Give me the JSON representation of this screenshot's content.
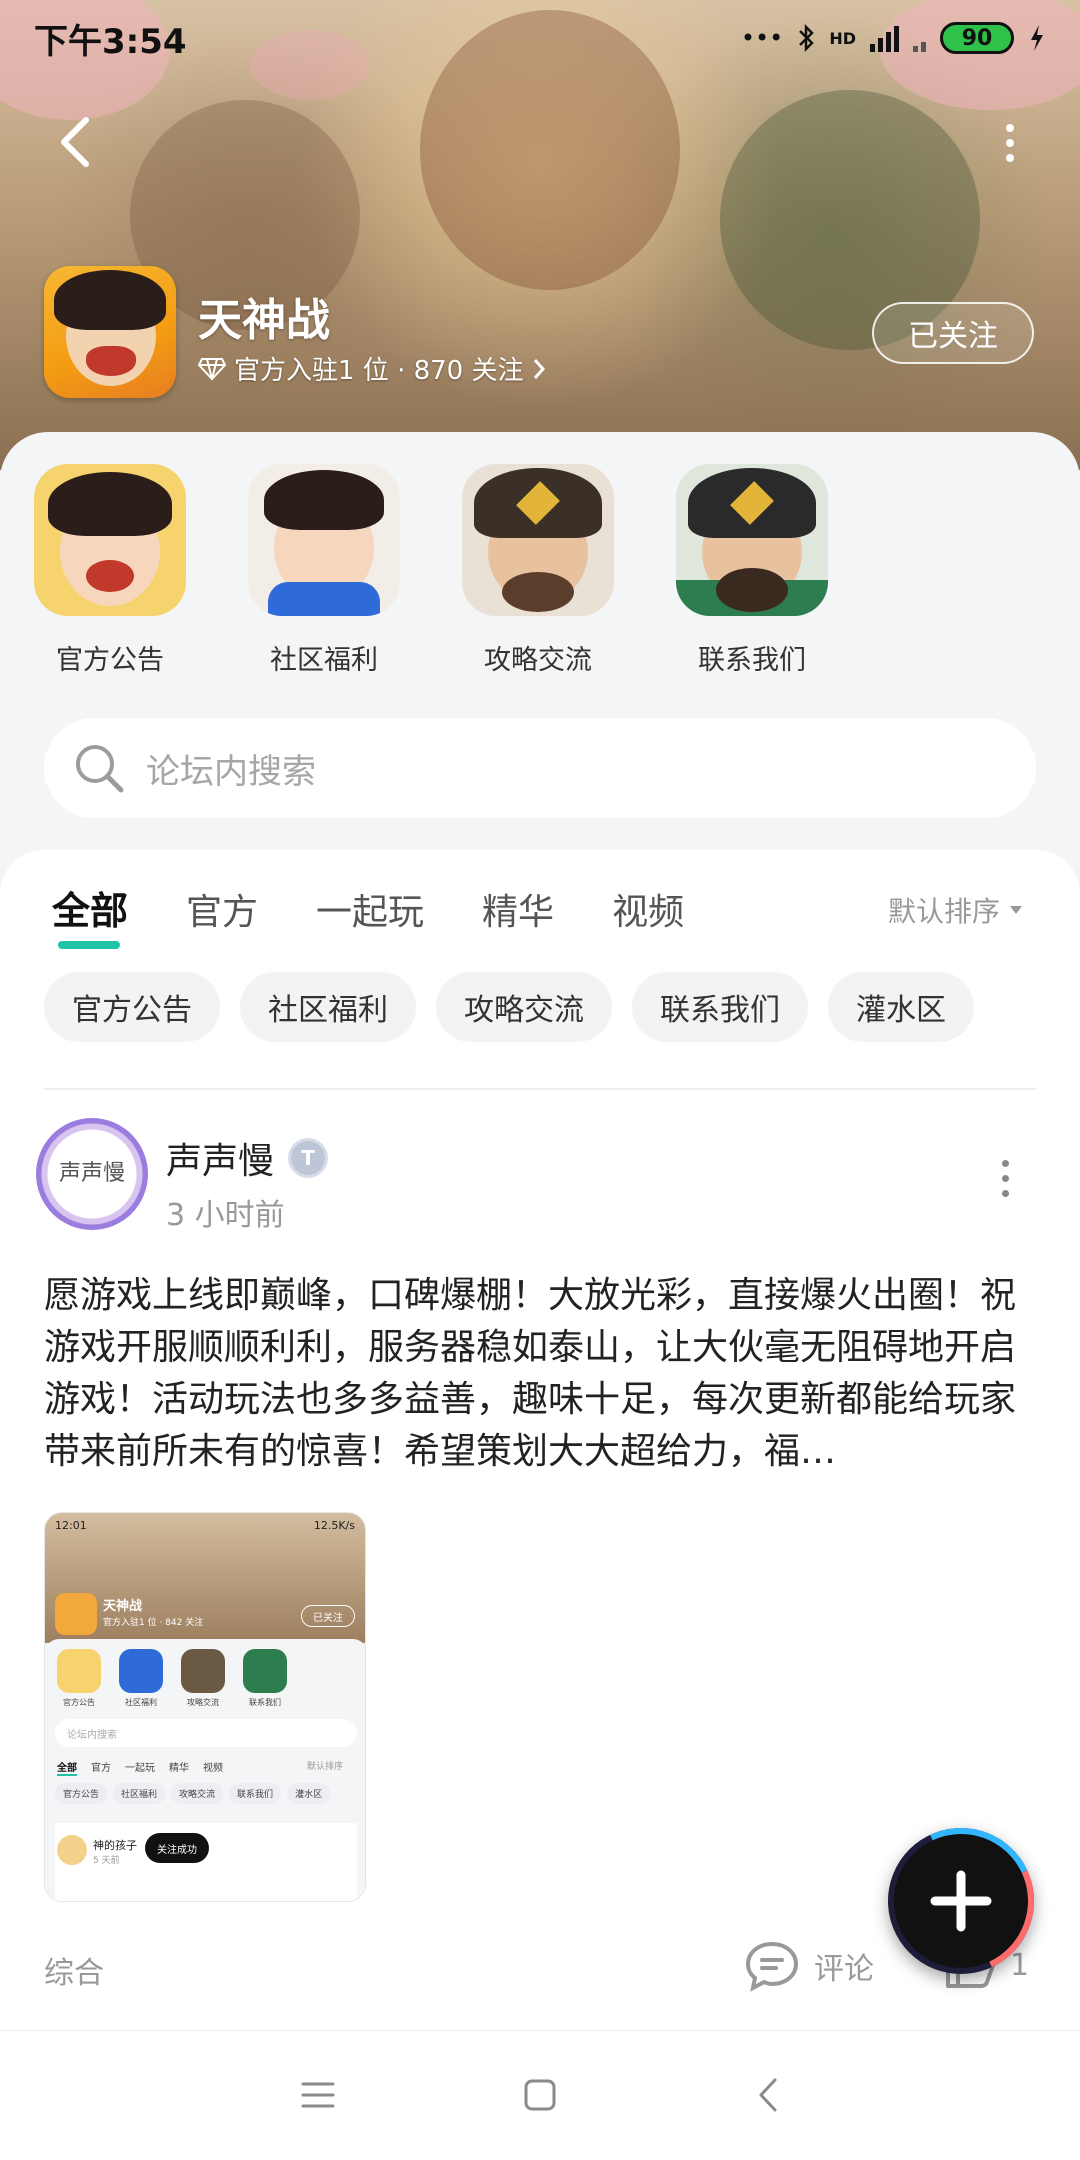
{
  "status_bar": {
    "time": "下午3:54",
    "network_label": "HD",
    "battery": "90"
  },
  "game": {
    "name": "天神战",
    "meta": "官方入驻1 位 · 870 关注",
    "follow_label": "已关注"
  },
  "forums": [
    {
      "label": "官方公告",
      "color": "#f6c74a"
    },
    {
      "label": "社区福利",
      "color": "#2f6bd8"
    },
    {
      "label": "攻略交流",
      "color": "#6b5a43"
    },
    {
      "label": "联系我们",
      "color": "#2e7d4f"
    }
  ],
  "search": {
    "placeholder": "论坛内搜索"
  },
  "tabs": [
    "全部",
    "官方",
    "一起玩",
    "精华",
    "视频"
  ],
  "sort_label": "默认排序",
  "chips": [
    "官方公告",
    "社区福利",
    "攻略交流",
    "联系我们",
    "灌水区"
  ],
  "post": {
    "author": "声声慢",
    "avatar_text": "声声慢",
    "time": "3 小时前",
    "text": "愿游戏上线即巅峰，口碑爆棚！大放光彩，直接爆火出圈！祝游戏开服顺顺利利，服务器稳如泰山，让大伙毫无阻碍地开启游戏！活动玩法也多多益善，趣味十足，每次更新都能给玩家带来前所未有的惊喜！希望策划大大超给力，福…",
    "category": "综合",
    "comment_label": "评论",
    "like_count": "1"
  },
  "thumbnail": {
    "time": "12:01",
    "net": "12.5K/s",
    "title": "天神战",
    "meta": "官方入驻1 位 · 842 关注",
    "follow": "已关注",
    "forums": [
      "官方公告",
      "社区福利",
      "攻略交流",
      "联系我们"
    ],
    "search": "论坛内搜索",
    "tabs": [
      "全部",
      "官方",
      "一起玩",
      "精华",
      "视频"
    ],
    "sort": "默认排序",
    "chips": [
      "官方公告",
      "社区福利",
      "攻略交流",
      "联系我们",
      "灌水区"
    ],
    "post_name": "神的孩子",
    "post_time": "5 天前",
    "toast": "关注成功"
  },
  "icons": {
    "back": "chevron-left-icon",
    "more": "more-vertical-icon",
    "search": "search-icon",
    "comment": "comment-icon",
    "like": "thumbs-up-icon",
    "add": "plus-icon"
  },
  "colors": {
    "accent": "#1fc4a6",
    "battery": "#2fc24a"
  }
}
